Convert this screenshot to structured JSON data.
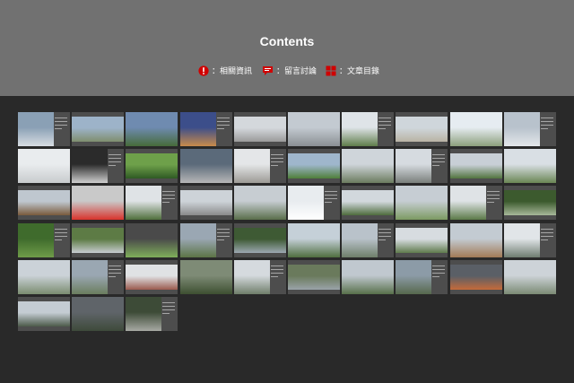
{
  "header": {
    "title": "Contents",
    "links": [
      {
        "icon": "info-icon",
        "label": "：相關資訊",
        "color": "#d00000"
      },
      {
        "icon": "comment-icon",
        "label": "：留言討論",
        "color": "#d00000"
      },
      {
        "icon": "grid-icon",
        "label": "：文章目錄",
        "color": "#d00000"
      }
    ]
  },
  "thumbnails": [
    [
      "photo",
      "#8aa0b5",
      "#d8dde2"
    ],
    [
      "photo",
      "#9db3c9",
      "#7f8e6e"
    ],
    [
      "photo",
      "#6f8bb0",
      "#466b3a"
    ],
    [
      "photo",
      "#3c4e8a",
      "#c98b4a"
    ],
    [
      "photo",
      "#d4d8dc",
      "#9a9a9a"
    ],
    [
      "photo",
      "#c3cad1",
      "#8a8f93"
    ],
    [
      "photo",
      "#dfe4e8",
      "#5f7d4a"
    ],
    [
      "photo",
      "#cfd6db",
      "#b9b3a4"
    ],
    [
      "photo",
      "#e6ecf1",
      "#8c9f7c"
    ],
    [
      "photo",
      "#b8c2cc",
      "#e3e7ea"
    ],
    [
      "photo",
      "#e9ecee",
      "#c8cbcd"
    ],
    [
      "photo",
      "#2b2b2b",
      "#cfcfcf"
    ],
    [
      "photo",
      "#6ea04a",
      "#2f5a24"
    ],
    [
      "photo",
      "#5b6a7a",
      "#b7b7b7"
    ],
    [
      "photo",
      "#e4e6e8",
      "#9c9a95"
    ],
    [
      "photo",
      "#9fb6cc",
      "#4f7f3a"
    ],
    [
      "photo",
      "#cfd5da",
      "#6b7b5e"
    ],
    [
      "photo",
      "#d6dbe0",
      "#7a7f7b"
    ],
    [
      "photo",
      "#c8cfd6",
      "#52743f"
    ],
    [
      "photo",
      "#d9dfe4",
      "#6a8654"
    ],
    [
      "photo",
      "#bfc7cf",
      "#7a5a3c"
    ],
    [
      "photo",
      "#c9c9c9",
      "#d8332c"
    ],
    [
      "photo",
      "#dfe3e6",
      "#4f6f3c"
    ],
    [
      "photo",
      "#cdd3d8",
      "#8a8a8a"
    ],
    [
      "photo",
      "#c7cdd2",
      "#596e4a"
    ],
    [
      "photo",
      "#e8ecef",
      "#ffffff"
    ],
    [
      "photo",
      "#d2d8dd",
      "#4e6b3c"
    ],
    [
      "photo",
      "#c6cdd3",
      "#7c9a62"
    ],
    [
      "photo",
      "#dfe3e6",
      "#5b7a48"
    ],
    [
      "photo",
      "#3c5a2e",
      "#a7b89a"
    ],
    [
      "photo",
      "#3f6b2c",
      "#6f9c49"
    ],
    [
      "photo",
      "#5d7b45",
      "#c7ccd0"
    ],
    [
      "photo",
      "#4a4a4a",
      "#7fae5a"
    ],
    [
      "photo",
      "#9aa7b3",
      "#5c7446"
    ],
    [
      "photo",
      "#3e5a34",
      "#9ca7b1"
    ],
    [
      "photo",
      "#c5d0d8",
      "#4f6e3f"
    ],
    [
      "photo",
      "#b9c2ca",
      "#6e7f6a"
    ],
    [
      "photo",
      "#d7dce0",
      "#5e7a4c"
    ],
    [
      "photo",
      "#c3cbd2",
      "#a27a56"
    ],
    [
      "photo",
      "#e1e5e8",
      "#6f7d70"
    ],
    [
      "photo",
      "#cbd2d8",
      "#7a8c70"
    ],
    [
      "photo",
      "#9aa7b2",
      "#6a7d5e"
    ],
    [
      "photo",
      "#e0e2e4",
      "#9b5a4e"
    ],
    [
      "photo",
      "#7e8b76",
      "#3d4f31"
    ],
    [
      "photo",
      "#d5dade",
      "#6f7e6a"
    ],
    [
      "photo",
      "#6a7a5c",
      "#9aa3a8"
    ],
    [
      "photo",
      "#c0c8cf",
      "#58704a"
    ],
    [
      "photo",
      "#8c9ba7",
      "#56684d"
    ],
    [
      "photo",
      "#5a5f66",
      "#c56a3a"
    ],
    [
      "photo",
      "#cdd3d8",
      "#7b8a74"
    ],
    [
      "photo",
      "#c4ccd3",
      "#4c5a4a"
    ],
    [
      "photo",
      "#5f6469",
      "#3e4a3a"
    ],
    [
      "photo",
      "#3d4b37",
      "#a7a9a3"
    ]
  ]
}
